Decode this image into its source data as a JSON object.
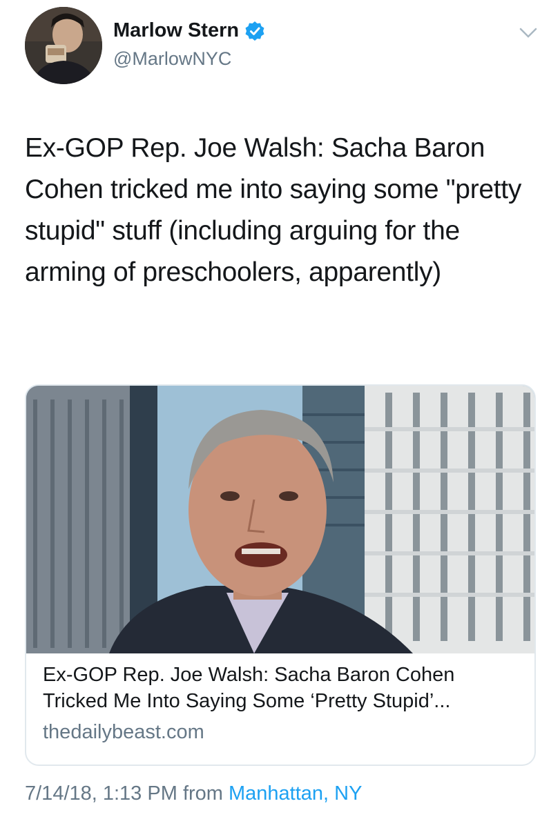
{
  "author": {
    "name": "Marlow Stern",
    "handle": "@MarlowNYC",
    "verified": true
  },
  "tweet": {
    "text": "Ex-GOP Rep. Joe Walsh: Sacha Baron Cohen tricked me into saying some \"pretty stupid\" stuff (including arguing for the arming of preschoolers, apparently)"
  },
  "card": {
    "title": "Ex-GOP Rep. Joe Walsh: Sacha Baron Cohen Tricked Me Into Saying Some ‘Pretty Stupid’...",
    "domain": "thedailybeast.com"
  },
  "meta": {
    "timestamp": "7/14/18, 1:13 PM",
    "from_label": "from",
    "location": "Manhattan, NY"
  },
  "colors": {
    "text": "#14171a",
    "secondary": "#657786",
    "link": "#1da1f2",
    "border": "#e1e8ed"
  }
}
